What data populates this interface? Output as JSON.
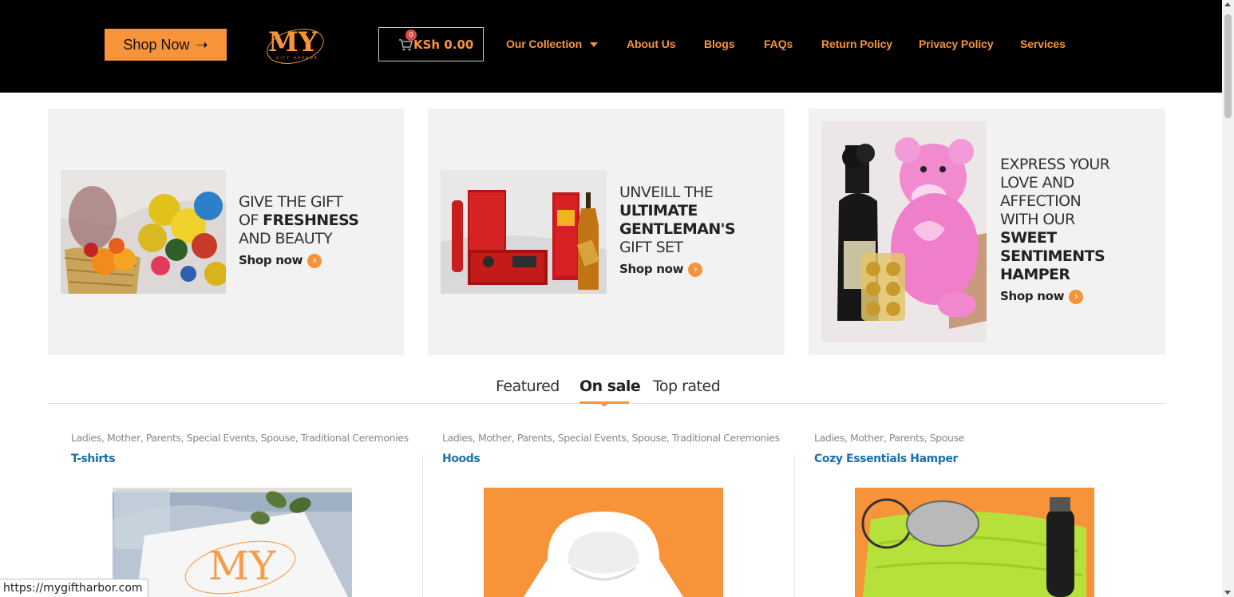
{
  "header": {
    "shop_now_label": "Shop Now",
    "logo_text": "MY",
    "logo_subtext": "GIFT HARBOR",
    "cart_badge": "0",
    "cart_total": "KSh 0.00",
    "nav": [
      {
        "label": "Our Collection"
      },
      {
        "label": "About Us"
      },
      {
        "label": "Blogs"
      },
      {
        "label": "FAQs"
      },
      {
        "label": "Return Policy"
      },
      {
        "label": "Privacy Policy"
      },
      {
        "label": "Services"
      }
    ]
  },
  "promos": [
    {
      "line1": "GIVE THE GIFT",
      "line2a": "OF ",
      "line2b": "FRESHNESS",
      "line3": "AND BEAUTY",
      "cta": "Shop now"
    },
    {
      "line1": "UNVEILL THE",
      "line2": "ULTIMATE",
      "line3": "GENTLEMAN'S",
      "line4": "GIFT SET",
      "cta": "Shop now"
    },
    {
      "line1": "EXPRESS YOUR",
      "line2": "LOVE AND",
      "line3": "AFFECTION",
      "line4": "WITH OUR",
      "line5": "SWEET",
      "line6": "SENTIMENTS",
      "line7": "HAMPER",
      "cta": "Shop now"
    }
  ],
  "tabs": [
    {
      "label": "Featured"
    },
    {
      "label": "On sale"
    },
    {
      "label": "Top rated"
    }
  ],
  "products": [
    {
      "categories": [
        "Ladies",
        "Mother",
        "Parents",
        "Special Events",
        "Spouse",
        "Traditional Ceremonies"
      ],
      "title": "T-shirts"
    },
    {
      "categories": [
        "Ladies",
        "Mother",
        "Parents",
        "Special Events",
        "Spouse",
        "Traditional Ceremonies"
      ],
      "title": "Hoods"
    },
    {
      "categories": [
        "Ladies",
        "Mother",
        "Parents",
        "Spouse"
      ],
      "title": "Cozy Essentials Hamper"
    }
  ],
  "status_url": "https://mygiftharbor.com",
  "colors": {
    "accent": "#f7943a",
    "header_bg": "#000000",
    "link": "#1a6fa8",
    "card_bg": "#f2f2f2"
  }
}
